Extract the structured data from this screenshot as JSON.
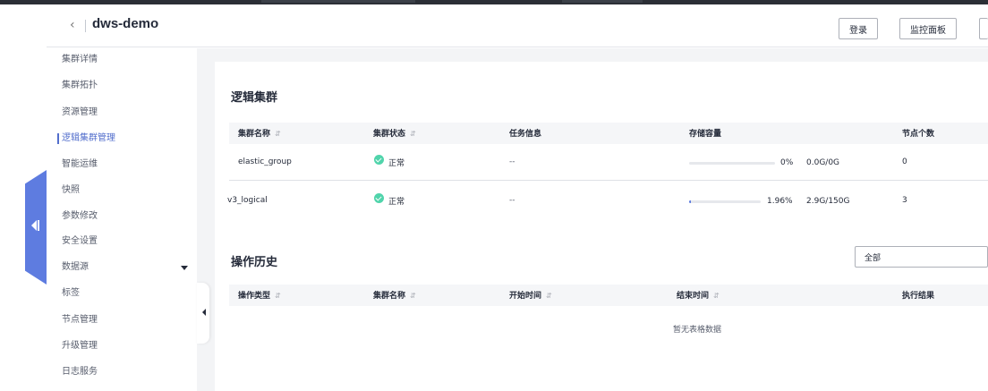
{
  "header": {
    "title": "dws-demo",
    "buttons": [
      "登录",
      "监控面板"
    ]
  },
  "sidebar": {
    "items": [
      "集群详情",
      "集群拓扑",
      "资源管理",
      "逻辑集群管理",
      "智能运维",
      "快照",
      "参数修改",
      "安全设置",
      "数据源",
      "标签",
      "节点管理",
      "升级管理",
      "日志服务"
    ],
    "active": "逻辑集群管理",
    "expandable": "数据源"
  },
  "logical_clusters": {
    "title": "逻辑集群",
    "columns": [
      "集群名称",
      "集群状态",
      "任务信息",
      "存储容量",
      "节点个数"
    ],
    "sortable": [
      true,
      true,
      false,
      false,
      false
    ],
    "rows": [
      {
        "name": "elastic_group",
        "status": "正常",
        "task": "--",
        "percent_label": "0%",
        "percent": 0,
        "capacity": "0.0G/0G",
        "nodes": "0"
      },
      {
        "name": "v3_logical",
        "status": "正常",
        "task": "--",
        "percent_label": "1.96%",
        "percent": 1.96,
        "capacity": "2.9G/150G",
        "nodes": "3"
      }
    ]
  },
  "operation_history": {
    "title": "操作历史",
    "filter_value": "全部",
    "columns": [
      "操作类型",
      "集群名称",
      "开始时间",
      "结束时间",
      "执行结果"
    ],
    "sortable": [
      true,
      true,
      true,
      true,
      false
    ],
    "empty_text": "暂无表格数据"
  },
  "colors": {
    "accent": "#526ecc",
    "collapse_tab": "#5e7ce0",
    "status_ok": "#50d4ab",
    "page_bg": "#f3f4f6"
  },
  "icons": {
    "back": "chevron-left-icon",
    "status": "check-circle-icon",
    "sort": "sort-icon",
    "collapse": "collapse-sidebar-icon",
    "dropdown": "caret-down-icon"
  }
}
